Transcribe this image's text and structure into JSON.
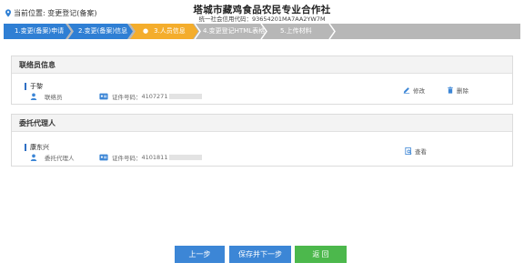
{
  "header": {
    "location_label": "当前位置: 变更登记(备案)",
    "org_name": "塔城市藏鸡食品农民专业合作社",
    "org_code": "统一社会信用代码：93654201MA7AA2YW7M"
  },
  "steps": [
    {
      "label": "1.变更(备案)申请",
      "state": "done"
    },
    {
      "label": "2.变更(备案)信息",
      "state": "done"
    },
    {
      "label": "3.人员信息",
      "state": "current"
    },
    {
      "label": "4.变更登记HTML表格",
      "state": "todo"
    },
    {
      "label": "5.上传材料",
      "state": "todo"
    }
  ],
  "contact_section": {
    "title": "联络员信息",
    "person": {
      "name": "于黎",
      "role": "联络员",
      "id_label": "证件号码：",
      "id_value": "4107271",
      "edit_label": "修改",
      "delete_label": "删除"
    }
  },
  "agent_section": {
    "title": "委托代理人",
    "person": {
      "name": "康东兴",
      "role": "委托代理人",
      "id_label": "证件号码：",
      "id_value": "4101811",
      "view_label": "查看"
    }
  },
  "buttons": {
    "prev": "上一步",
    "save_next": "保存并下一步",
    "back": "返 回"
  },
  "colors": {
    "step_done": "#2f7fd4",
    "step_current": "#f4ad2c",
    "step_todo": "#b7b7b7",
    "button_blue": "#3c86d6",
    "button_green": "#4cb84c"
  }
}
